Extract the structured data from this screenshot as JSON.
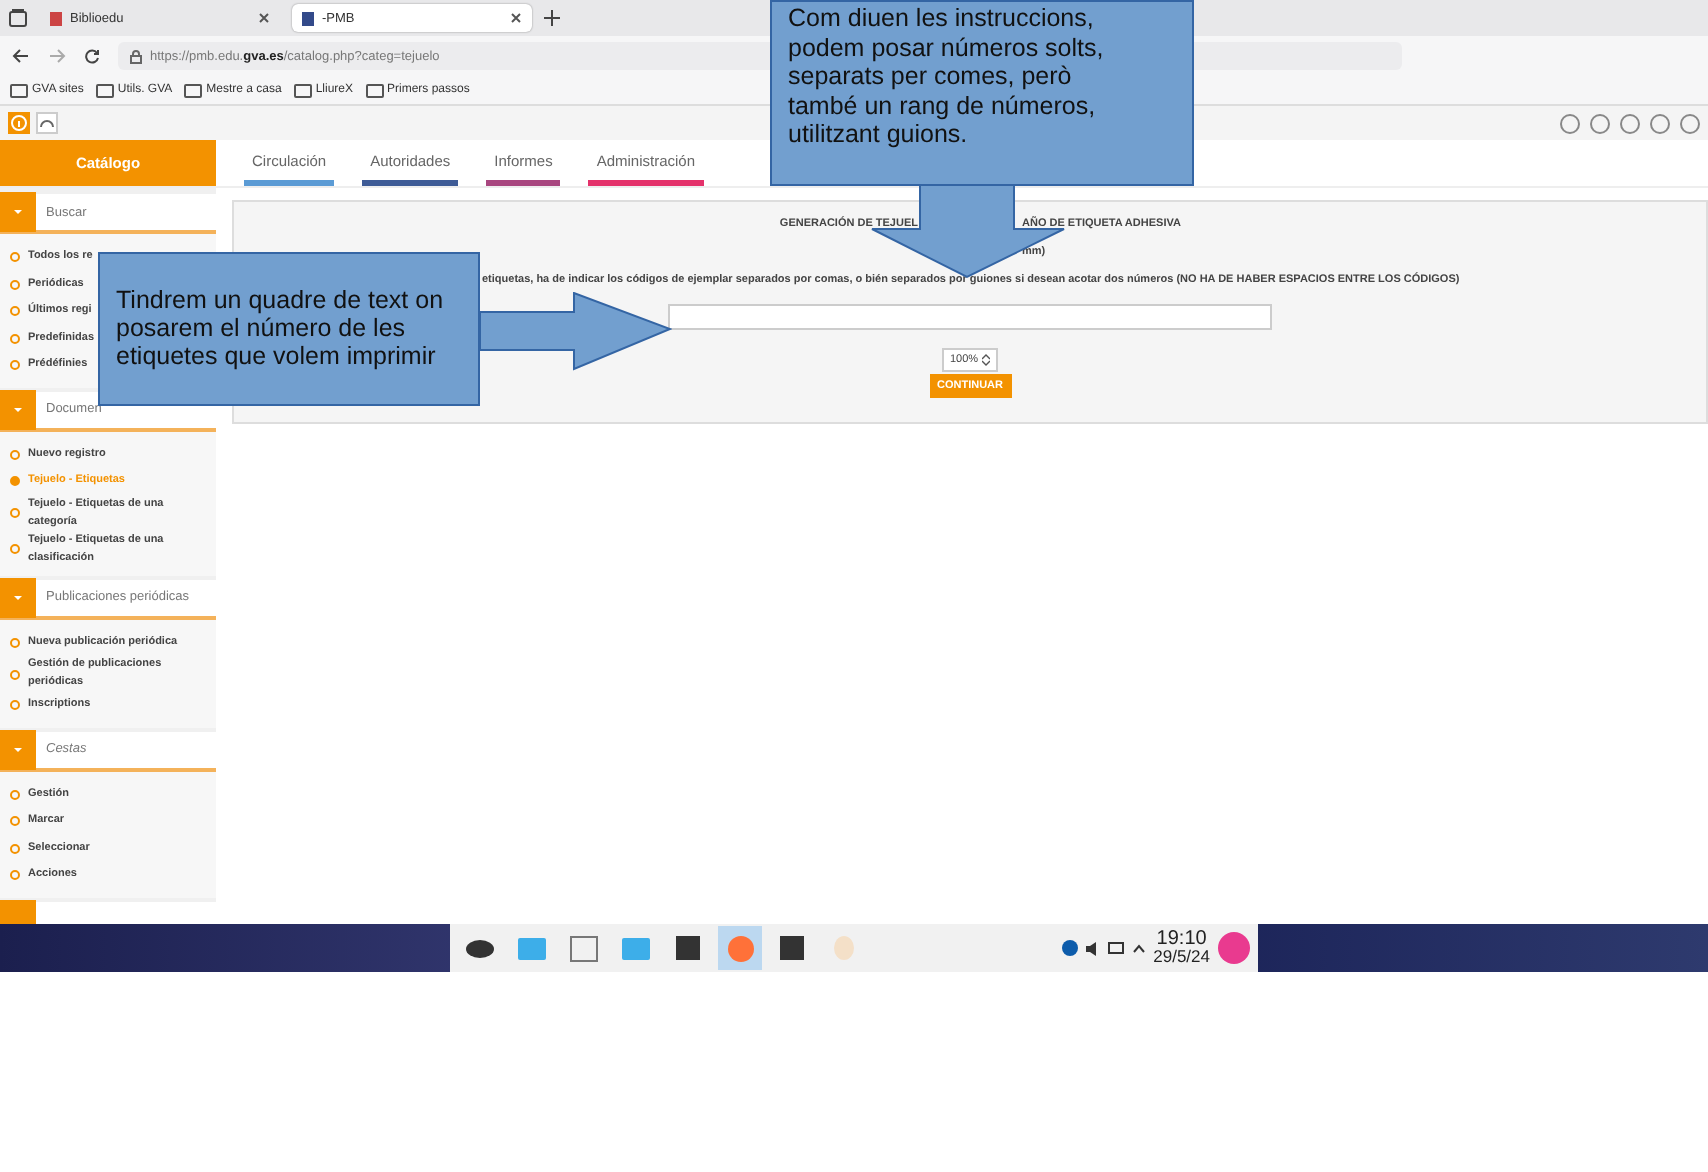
{
  "browser": {
    "tabs": [
      {
        "label": "Biblioedu",
        "selected": false
      },
      {
        "label": "-PMB",
        "selected": true
      }
    ],
    "address": "https://pmb.edu.**gva.es**/catalog.php?categ=tejuelo",
    "bookmarks": [
      "GVA sites",
      "Utils. GVA",
      "Mestre a casa",
      "LliureX",
      "Primers passos"
    ]
  },
  "app": {
    "section_title": "Catálogo",
    "tabs": [
      {
        "label": "Circulación",
        "color": "#5b9bd5"
      },
      {
        "label": "Autoridades",
        "color": "#3e5b96"
      },
      {
        "label": "Informes",
        "color": "#a8467f"
      },
      {
        "label": "Administración",
        "color": "#e4326b"
      }
    ]
  },
  "sidebar": [
    {
      "title": "Buscar",
      "items": [
        {
          "label": "Todos los re",
          "selected": false
        },
        {
          "label": "Periódicas",
          "selected": false
        },
        {
          "label": "Últimos regi",
          "selected": false
        },
        {
          "label": "Predefinidas",
          "selected": false
        },
        {
          "label": "Prédéfinies",
          "selected": false
        }
      ]
    },
    {
      "title": "Documen",
      "items": [
        {
          "label": "Nuevo registro",
          "selected": false
        },
        {
          "label": "Tejuelo - Etiquetas",
          "selected": true
        },
        {
          "label": "Tejuelo - Etiquetas de una categoría",
          "selected": false
        },
        {
          "label": "Tejuelo - Etiquetas de una clasificación",
          "selected": false
        }
      ]
    },
    {
      "title": "Publicaciones periódicas",
      "items": [
        {
          "label": "Nueva publicación periódica",
          "selected": false
        },
        {
          "label": "Gestión de publicaciones periódicas",
          "selected": false
        },
        {
          "label": "Inscriptions",
          "selected": false
        }
      ]
    },
    {
      "title": "Cestas",
      "items": [
        {
          "label": "Gestión",
          "selected": false
        },
        {
          "label": "Marcar",
          "selected": false
        },
        {
          "label": "Seleccionar",
          "selected": false
        },
        {
          "label": "Acciones",
          "selected": false
        }
      ]
    }
  ],
  "form": {
    "title_left": "GENERACIÓN DE TEJUEL",
    "title_right": "AÑO DE ETIQUETA ADHESIVA",
    "subtitle_fragment": "mm)",
    "instructions": "etiquetas, ha de indicar los códigos de ejemplar separados por comas, o bién separados por guiones si desean acotar dos números (NO HA DE HABER ESPACIOS ENTRE LOS CÓDIGOS)",
    "scale": "100%",
    "submit": "CONTINUAR"
  },
  "callouts": [
    {
      "text": "Com diuen les instruccions, podem posar números solts, separats per comes, però també un rang de números, utilitzant guions."
    },
    {
      "text": "Tindrem un quadre de text on posarem el número de les etiquetes que volem imprimir"
    }
  ],
  "taskbar": {
    "time": "19:10",
    "date": "29/5/24"
  }
}
